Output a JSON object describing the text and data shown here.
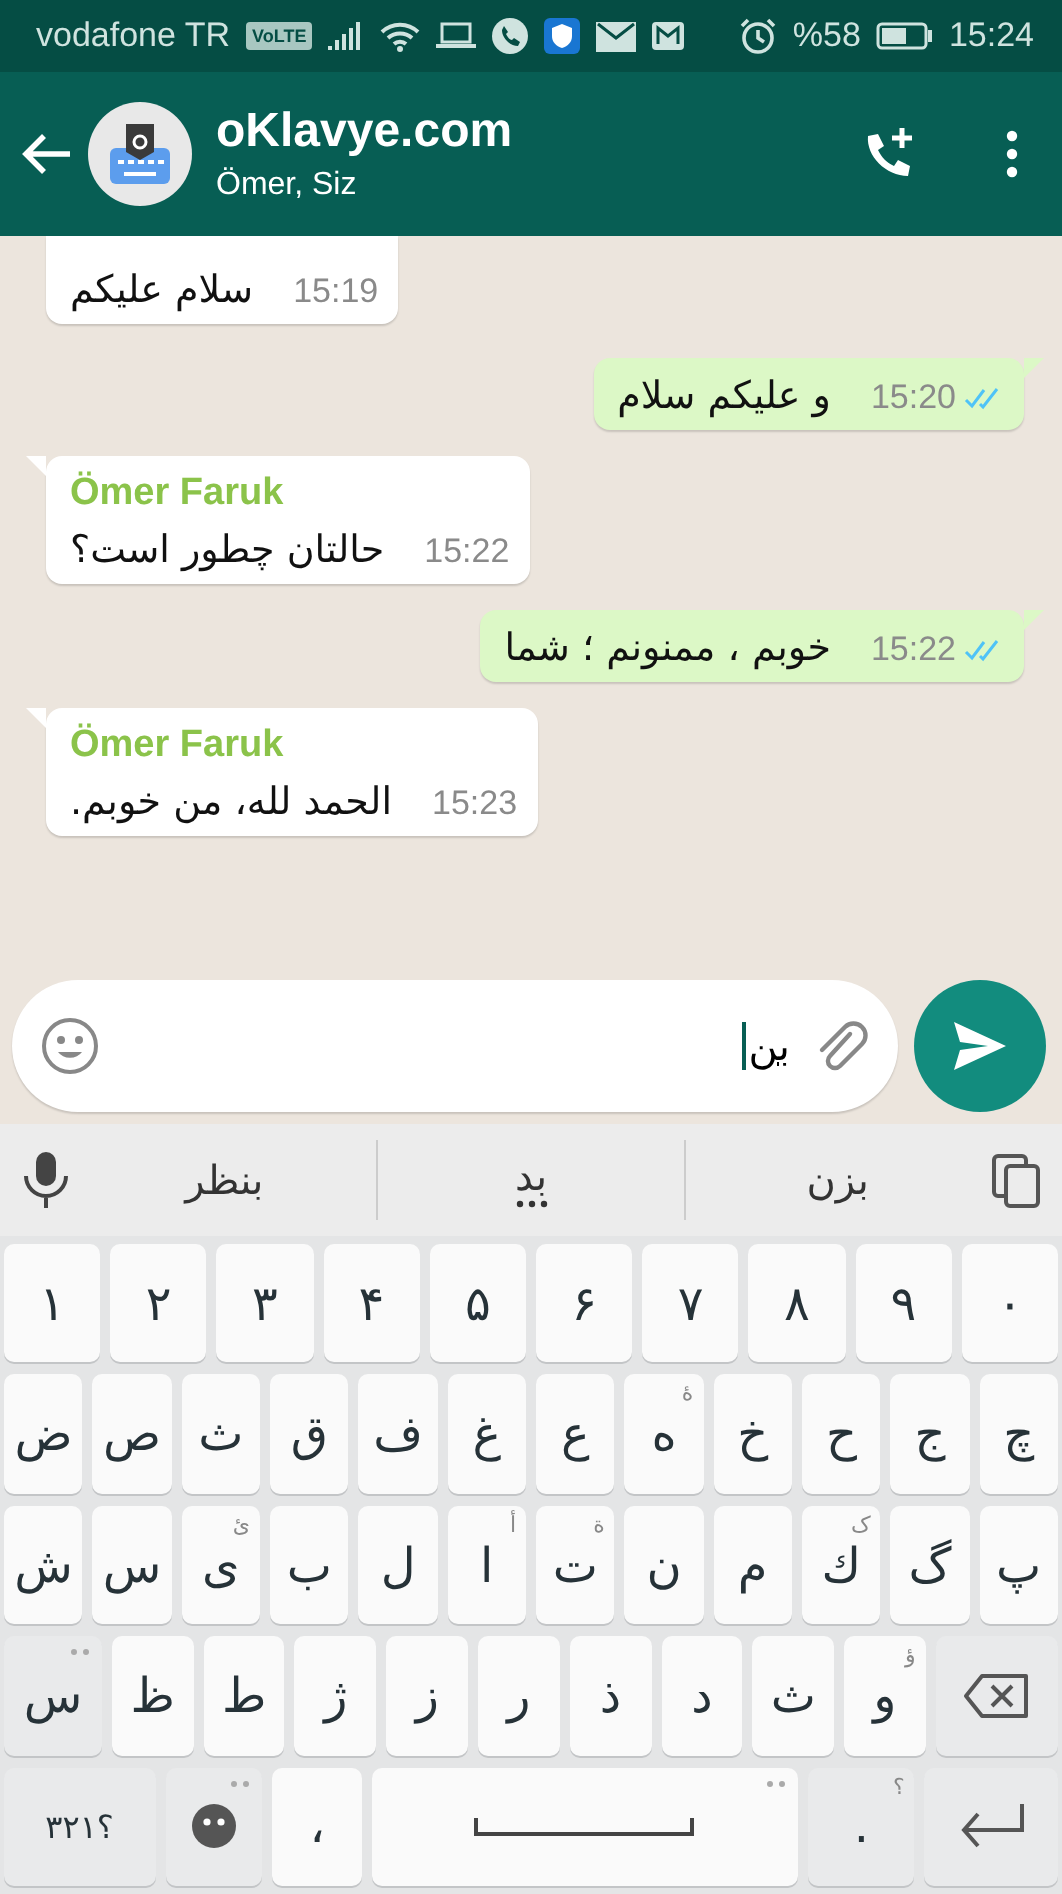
{
  "status_bar": {
    "carrier": "vodafone TR",
    "volte": "VoLTE",
    "battery_text": "%58",
    "time": "15:24"
  },
  "header": {
    "title": "oKlavye.com",
    "subtitle": "Ömer, Siz"
  },
  "messages": [
    {
      "outgoing": false,
      "text": "سلام علیکم",
      "time": "15:19"
    },
    {
      "outgoing": true,
      "text": "و علیکم سلام",
      "time": "15:20",
      "read": true
    },
    {
      "outgoing": false,
      "sender": "Ömer Faruk",
      "text": "حالتان چطور است؟",
      "time": "15:22"
    },
    {
      "outgoing": true,
      "text": "خوبم ، ممنونم ؛ شما",
      "time": "15:22",
      "read": true
    },
    {
      "outgoing": false,
      "sender": "Ömer Faruk",
      "text": "الحمد لله، من خوبم.",
      "time": "15:23"
    }
  ],
  "composer": {
    "value": "بن"
  },
  "suggestions": [
    {
      "text": "بزن",
      "more": false
    },
    {
      "text": "بد",
      "more": true
    },
    {
      "text": "بنظر",
      "more": false
    }
  ],
  "keyboard": [
    [
      {
        "kind": "letter",
        "label": "۰"
      },
      {
        "kind": "letter",
        "label": "۹"
      },
      {
        "kind": "letter",
        "label": "۸"
      },
      {
        "kind": "letter",
        "label": "۷"
      },
      {
        "kind": "letter",
        "label": "۶"
      },
      {
        "kind": "letter",
        "label": "۵"
      },
      {
        "kind": "letter",
        "label": "۴"
      },
      {
        "kind": "letter",
        "label": "۳"
      },
      {
        "kind": "letter",
        "label": "۲"
      },
      {
        "kind": "letter",
        "label": "۱"
      }
    ],
    [
      {
        "kind": "letter",
        "label": "چ"
      },
      {
        "kind": "letter",
        "label": "ج"
      },
      {
        "kind": "letter",
        "label": "ح"
      },
      {
        "kind": "letter",
        "label": "خ"
      },
      {
        "kind": "letter",
        "label": "ه",
        "hint": "ۀ"
      },
      {
        "kind": "letter",
        "label": "ع"
      },
      {
        "kind": "letter",
        "label": "غ"
      },
      {
        "kind": "letter",
        "label": "ف"
      },
      {
        "kind": "letter",
        "label": "ق"
      },
      {
        "kind": "letter",
        "label": "ث"
      },
      {
        "kind": "letter",
        "label": "ص"
      },
      {
        "kind": "letter",
        "label": "ض"
      }
    ],
    [
      {
        "kind": "letter",
        "label": "پ"
      },
      {
        "kind": "letter",
        "label": "گ"
      },
      {
        "kind": "letter",
        "label": "ك",
        "hint": "ک"
      },
      {
        "kind": "letter",
        "label": "م"
      },
      {
        "kind": "letter",
        "label": "ن"
      },
      {
        "kind": "letter",
        "label": "ت",
        "hint": "ة"
      },
      {
        "kind": "letter",
        "label": "ا",
        "hint": "أ"
      },
      {
        "kind": "letter",
        "label": "ل"
      },
      {
        "kind": "letter",
        "label": "ب"
      },
      {
        "kind": "letter",
        "label": "ی",
        "hint": "ئ"
      },
      {
        "kind": "letter",
        "label": "س"
      },
      {
        "kind": "letter",
        "label": "ش"
      }
    ],
    [
      {
        "kind": "backspace"
      },
      {
        "kind": "letter",
        "label": "و",
        "hint": "ؤ"
      },
      {
        "kind": "letter",
        "label": "ث"
      },
      {
        "kind": "letter",
        "label": "د"
      },
      {
        "kind": "letter",
        "label": "ذ"
      },
      {
        "kind": "letter",
        "label": "ر"
      },
      {
        "kind": "letter",
        "label": "ز"
      },
      {
        "kind": "letter",
        "label": "ژ"
      },
      {
        "kind": "letter",
        "label": "ط"
      },
      {
        "kind": "letter",
        "label": "ظ"
      },
      {
        "kind": "function",
        "label": "س",
        "more": true
      }
    ],
    [
      {
        "kind": "enter"
      },
      {
        "kind": "function",
        "label": ".",
        "hint": "؟"
      },
      {
        "kind": "space",
        "more": true
      },
      {
        "kind": "letter",
        "label": "،"
      },
      {
        "kind": "emoji",
        "more": true
      },
      {
        "kind": "function",
        "label": "؟۳۲۱"
      }
    ]
  ]
}
